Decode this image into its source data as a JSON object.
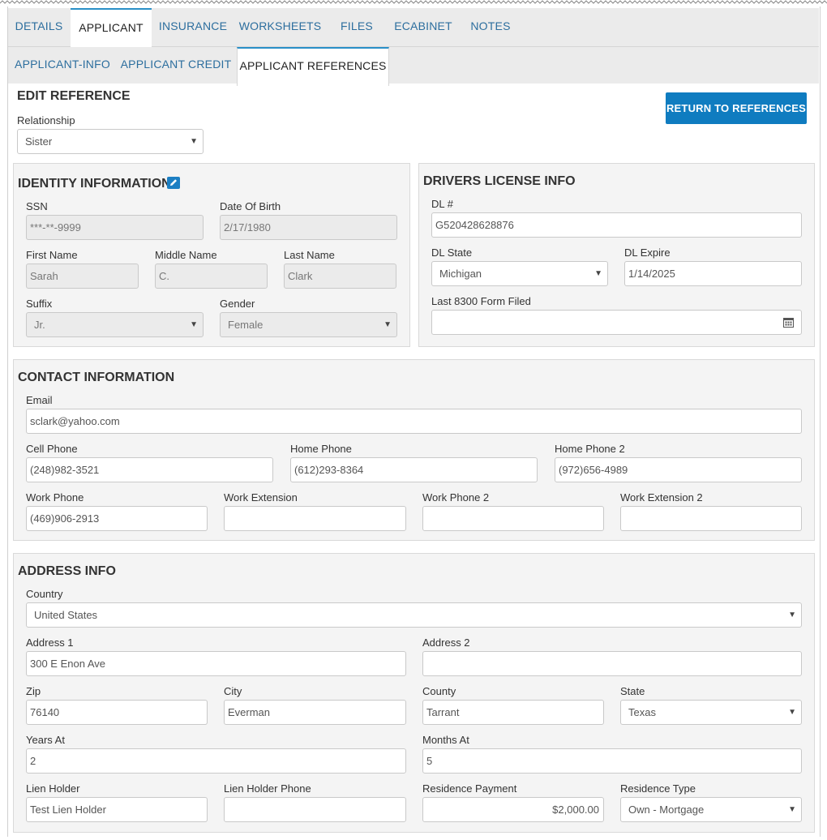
{
  "tabs_main": [
    {
      "label": "DETAILS",
      "active": false
    },
    {
      "label": "APPLICANT",
      "active": true
    },
    {
      "label": "INSURANCE",
      "active": false
    },
    {
      "label": "WORKSHEETS",
      "active": false
    },
    {
      "label": "FILES",
      "active": false
    },
    {
      "label": "ECABINET",
      "active": false
    },
    {
      "label": "NOTES",
      "active": false
    }
  ],
  "tabs_sub": [
    {
      "label": "APPLICANT-INFO",
      "active": false
    },
    {
      "label": "APPLICANT CREDIT",
      "active": false
    },
    {
      "label": "APPLICANT REFERENCES",
      "active": true
    }
  ],
  "edit": {
    "heading": "EDIT REFERENCE",
    "relationship_label": "Relationship",
    "relationship_value": "Sister",
    "return_button": "RETURN TO REFERENCES"
  },
  "identity": {
    "title": "IDENTITY INFORMATION",
    "ssn_label": "SSN",
    "ssn_value": "***-**-9999",
    "dob_label": "Date Of Birth",
    "dob_value": "2/17/1980",
    "first_label": "First Name",
    "first_value": "Sarah",
    "middle_label": "Middle Name",
    "middle_value": "C.",
    "last_label": "Last Name",
    "last_value": "Clark",
    "suffix_label": "Suffix",
    "suffix_value": "Jr.",
    "gender_label": "Gender",
    "gender_value": "Female"
  },
  "dl": {
    "title": "DRIVERS LICENSE INFO",
    "num_label": "DL #",
    "num_value": "G520428628876",
    "state_label": "DL State",
    "state_value": "Michigan",
    "expire_label": "DL Expire",
    "expire_value": "1/14/2025",
    "form_label": "Last 8300 Form Filed",
    "form_value": ""
  },
  "contact": {
    "title": "CONTACT INFORMATION",
    "email_label": "Email",
    "email_value": "sclark@yahoo.com",
    "cell_label": "Cell Phone",
    "cell_value": "(248)982-3521",
    "home_label": "Home Phone",
    "home_value": "(612)293-8364",
    "home2_label": "Home Phone 2",
    "home2_value": "(972)656-4989",
    "work_label": "Work Phone",
    "work_value": "(469)906-2913",
    "workext_label": "Work Extension",
    "workext_value": "",
    "work2_label": "Work Phone 2",
    "work2_value": "",
    "workext2_label": "Work Extension 2",
    "workext2_value": ""
  },
  "address": {
    "title": "ADDRESS INFO",
    "country_label": "Country",
    "country_value": "United States",
    "addr1_label": "Address 1",
    "addr1_value": "300 E Enon Ave",
    "addr2_label": "Address 2",
    "addr2_value": "",
    "zip_label": "Zip",
    "zip_value": "76140",
    "city_label": "City",
    "city_value": "Everman",
    "county_label": "County",
    "county_value": "Tarrant",
    "state_label": "State",
    "state_value": "Texas",
    "years_label": "Years At",
    "years_value": "2",
    "months_label": "Months At",
    "months_value": "5",
    "lien_label": "Lien Holder",
    "lien_value": "Test Lien Holder",
    "lienphone_label": "Lien Holder Phone",
    "lienphone_value": "",
    "payment_label": "Residence Payment",
    "payment_value": "$2,000.00",
    "restype_label": "Residence Type",
    "restype_value": "Own - Mortgage"
  }
}
